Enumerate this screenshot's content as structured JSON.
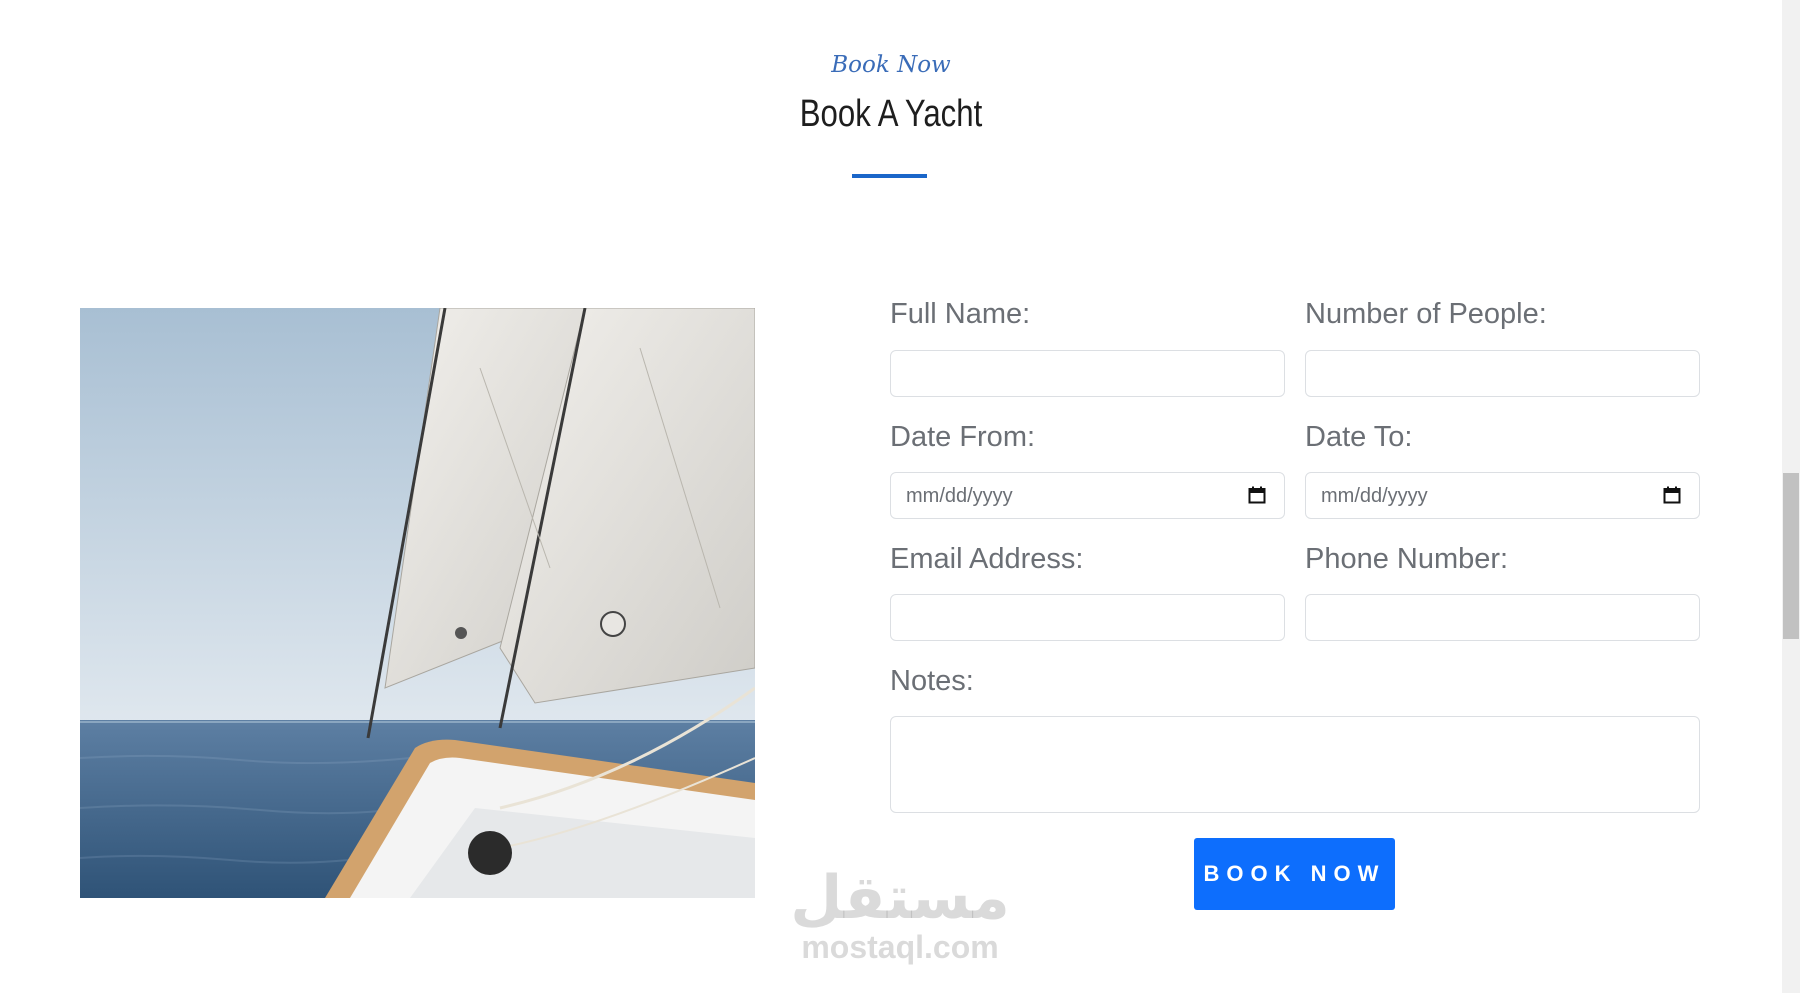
{
  "section": {
    "eyebrow": "Book Now",
    "title": "Book A Yacht",
    "accent_color": "#1a66c9"
  },
  "form": {
    "full_name_label": "Full Name:",
    "people_label": "Number of People:",
    "date_from_label": "Date From:",
    "date_to_label": "Date To:",
    "date_placeholder": "mm/dd/yyyy",
    "email_label": "Email Address:",
    "phone_label": "Phone Number:",
    "notes_label": "Notes:",
    "submit_label": "BOOK NOW",
    "button_color": "#0d6efd"
  },
  "watermark": {
    "logo_text": "مستقل",
    "site_text": "mostaql.com"
  }
}
